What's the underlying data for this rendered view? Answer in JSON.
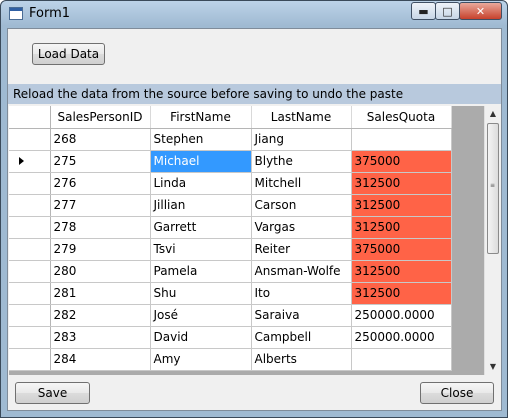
{
  "window": {
    "title": "Form1"
  },
  "toolbar": {
    "load_label": "Load Data"
  },
  "info_text": "Reload the data from the source before saving to undo the paste",
  "grid": {
    "columns": [
      "SalesPersonID",
      "FirstName",
      "LastName",
      "SalesQuota"
    ],
    "current_row_index": 1,
    "rows": [
      {
        "id": "268",
        "first": "Stephen",
        "last": "Jiang",
        "quota": ""
      },
      {
        "id": "275",
        "first": "Michael",
        "last": "Blythe",
        "quota": "375000"
      },
      {
        "id": "276",
        "first": "Linda",
        "last": "Mitchell",
        "quota": "312500"
      },
      {
        "id": "277",
        "first": "Jillian",
        "last": "Carson",
        "quota": "312500"
      },
      {
        "id": "278",
        "first": "Garrett",
        "last": "Vargas",
        "quota": "312500"
      },
      {
        "id": "279",
        "first": "Tsvi",
        "last": "Reiter",
        "quota": "375000"
      },
      {
        "id": "280",
        "first": "Pamela",
        "last": "Ansman-Wolfe",
        "quota": "312500"
      },
      {
        "id": "281",
        "first": "Shu",
        "last": "Ito",
        "quota": "312500"
      },
      {
        "id": "282",
        "first": "José",
        "last": "Saraiva",
        "quota": "250000.0000"
      },
      {
        "id": "283",
        "first": "David",
        "last": "Campbell",
        "quota": "250000.0000"
      },
      {
        "id": "284",
        "first": "Amy",
        "last": "Alberts",
        "quota": ""
      }
    ]
  },
  "footer": {
    "save_label": "Save",
    "close_label": "Close"
  },
  "colors": {
    "pasted_cell": "#ff6347",
    "selected_cell": "#3399ff",
    "info_bar": "#b8c9dd"
  }
}
